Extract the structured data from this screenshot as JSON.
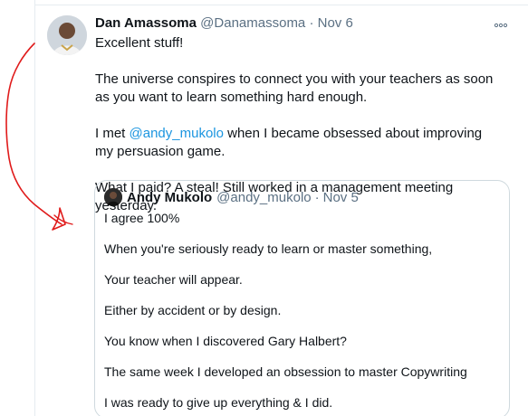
{
  "tweet": {
    "author_name": "Dan Amassoma",
    "handle": "@Danamassoma",
    "separator": "·",
    "date": "Nov 6",
    "more_icon": "more-icon",
    "lines": {
      "l1": "Excellent stuff!",
      "l2": "The universe conspires to connect you with your teachers as soon as you want to learn something hard enough.",
      "l3_before": "I met ",
      "l3_mention": "@andy_mukolo",
      "l3_after": " when I became obsessed about improving my persuasion game.",
      "l4": "What I paid? A steal! Still worked in a management meeting yesterday."
    }
  },
  "quote": {
    "author_name": "Andy Mukolo",
    "handle": "@andy_mukolo",
    "separator": "·",
    "date": "Nov 5",
    "lines": [
      "I agree 100%",
      "When you're seriously ready to learn or master something,",
      "Your teacher will appear.",
      "Either by accident or by design.",
      "You know when I discovered Gary Halbert?",
      "The same week I developed an obsession to master Copywriting",
      "I was ready to give up everything & I did."
    ]
  },
  "colors": {
    "link": "#1b95e0",
    "muted": "#5b7083",
    "annotation": "#e01b1b"
  }
}
